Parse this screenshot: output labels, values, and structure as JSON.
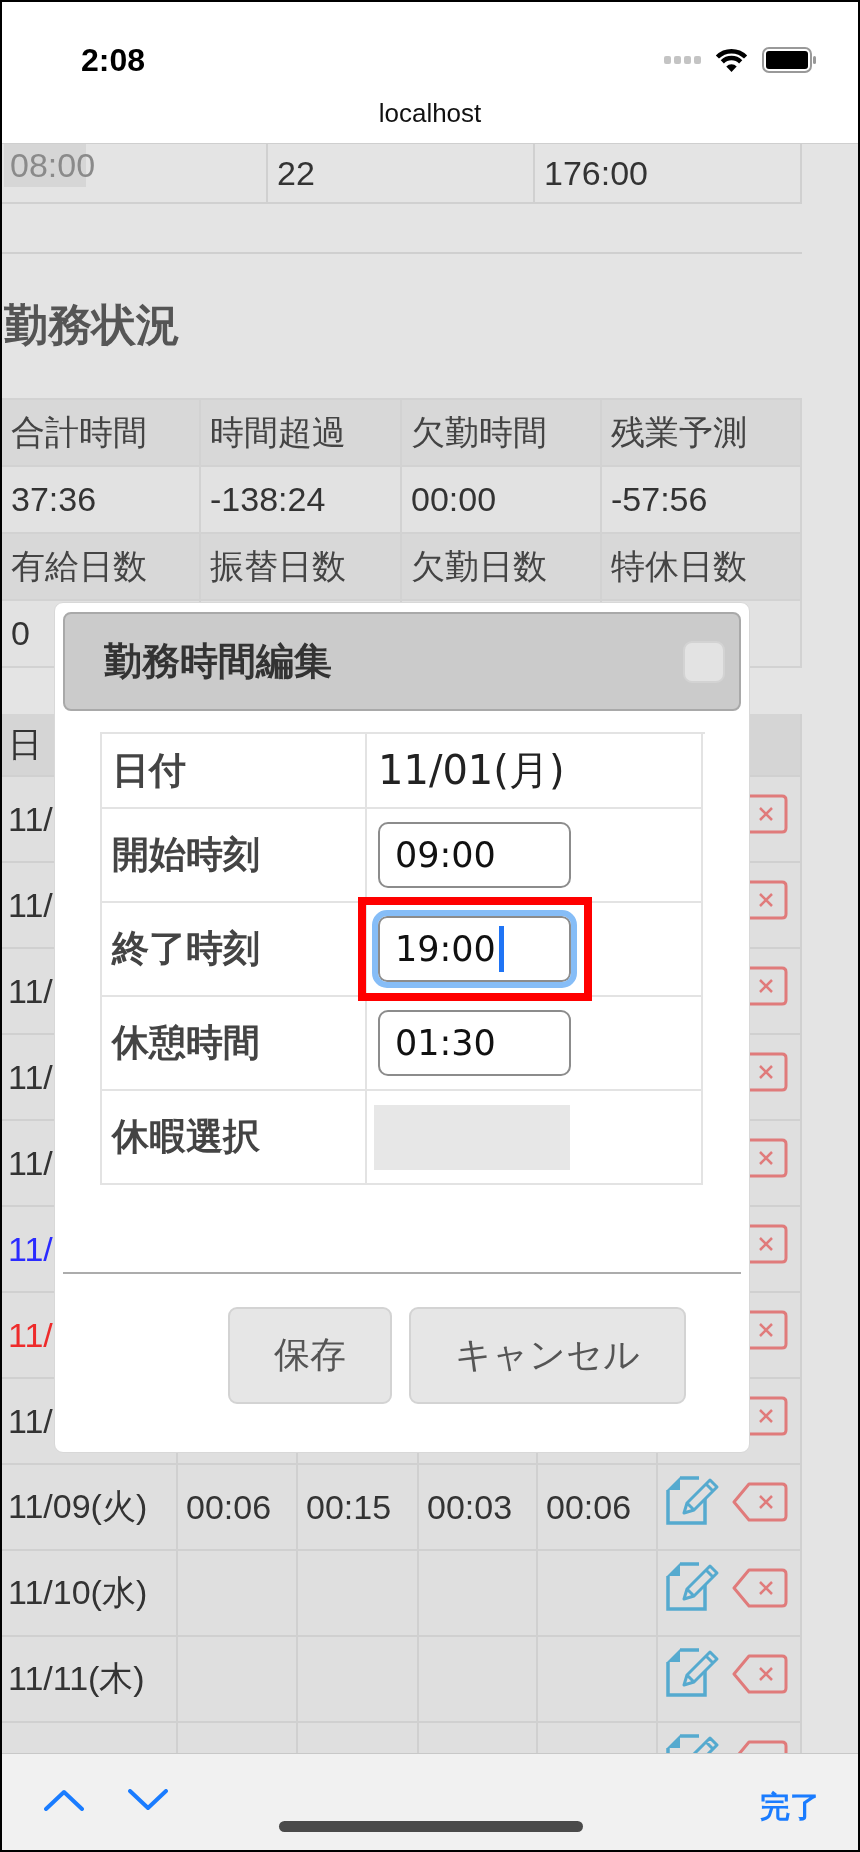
{
  "status_bar": {
    "time": "2:08",
    "url": "localhost"
  },
  "top_table": {
    "cells": [
      "08:00",
      "22",
      "176:00"
    ]
  },
  "section_title": "勤務状況",
  "summary": {
    "rows": [
      {
        "kind": "header",
        "cells": [
          "合計時間",
          "時間超過",
          "欠勤時間",
          "残業予測"
        ]
      },
      {
        "kind": "value",
        "cells": [
          "37:36",
          "-138:24",
          "00:00",
          "-57:56"
        ]
      },
      {
        "kind": "header",
        "cells": [
          "有給日数",
          "振替日数",
          "欠勤日数",
          "特休日数"
        ]
      },
      {
        "kind": "value",
        "cells": [
          "0"
        ]
      }
    ]
  },
  "table": {
    "columns": [
      "日"
    ],
    "rows": [
      {
        "date": "11/",
        "color": "#333333"
      },
      {
        "date": "11/",
        "color": "#333333"
      },
      {
        "date": "11/",
        "color": "#333333"
      },
      {
        "date": "11/",
        "color": "#333333"
      },
      {
        "date": "11/",
        "color": "#333333"
      },
      {
        "date": "11/",
        "color": "#2b2bff"
      },
      {
        "date": "11/",
        "color": "#ee2b2b"
      },
      {
        "date": "11/",
        "color": "#333333"
      },
      {
        "date": "11/09(火)",
        "color": "#333333",
        "cells": [
          "00:06",
          "00:15",
          "00:03",
          "00:06"
        ]
      },
      {
        "date": "11/10(水)",
        "color": "#333333"
      },
      {
        "date": "11/11(木)",
        "color": "#333333"
      }
    ]
  },
  "dialog": {
    "title": "勤務時間編集",
    "fields": [
      {
        "kind": "text",
        "label": "日付",
        "value": "11/01(月)"
      },
      {
        "kind": "input",
        "label": "開始時刻",
        "value": "09:00",
        "focused": false,
        "highlighted": false
      },
      {
        "kind": "input",
        "label": "終了時刻",
        "value": "19:00",
        "focused": true,
        "highlighted": true
      },
      {
        "kind": "input",
        "label": "休憩時間",
        "value": "01:30",
        "focused": false,
        "highlighted": false
      },
      {
        "kind": "select",
        "label": "休暇選択"
      }
    ],
    "buttons": [
      "保存",
      "キャンセル"
    ]
  },
  "keyboard_toolbar": {
    "done": "完了"
  }
}
